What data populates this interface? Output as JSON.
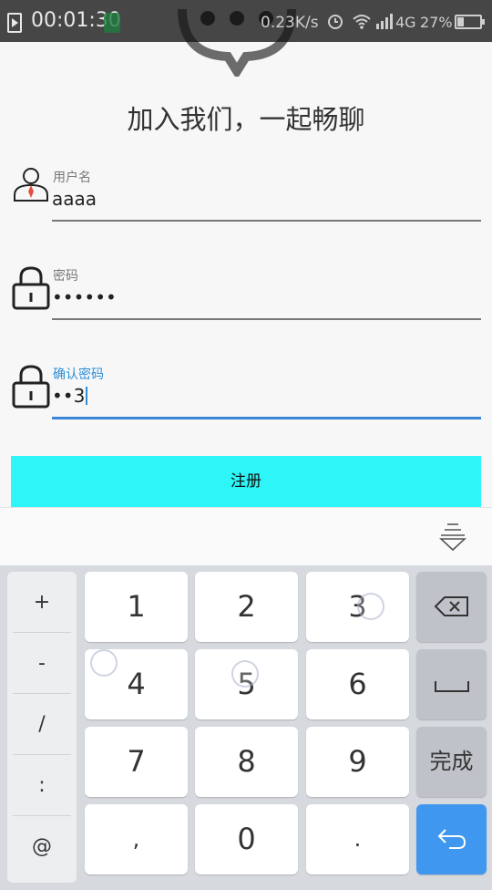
{
  "status_bar": {
    "time": "00:01:30",
    "net_speed": "0.23K/s",
    "network": "4G",
    "battery": "27%",
    "battery_level": 0.27
  },
  "page": {
    "title": "加入我们，一起畅聊"
  },
  "form": {
    "username": {
      "label": "用户名",
      "value": "aaaa"
    },
    "password": {
      "label": "密码",
      "value": "••••••"
    },
    "confirm": {
      "label": "确认密码",
      "value": "••3"
    },
    "register_label": "注册"
  },
  "keyboard": {
    "symbols": [
      "+",
      "-",
      "/",
      ":",
      "@"
    ],
    "keys": [
      "1",
      "2",
      "3",
      "4",
      "5",
      "6",
      "7",
      "8",
      "9",
      ",",
      "0",
      "."
    ],
    "done_label": "完成"
  },
  "colors": {
    "accent": "#2f8fd8",
    "button": "#2ef5f7",
    "enter": "#3f97f0"
  }
}
